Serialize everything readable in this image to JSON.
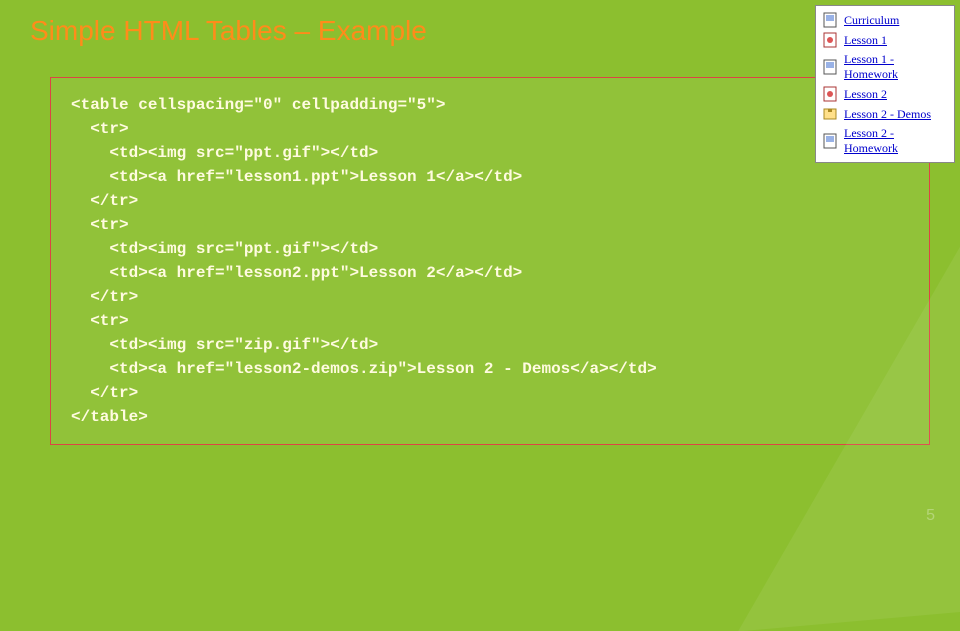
{
  "slide": {
    "title": "Simple HTML Tables – Example",
    "page_number": "5"
  },
  "code": {
    "line1": "<table cellspacing=\"0\" cellpadding=\"5\">",
    "line2": "  <tr>",
    "line3": "    <td><img src=\"ppt.gif\"></td>",
    "line4": "    <td><a href=\"lesson1.ppt\">Lesson 1</a></td>",
    "line5": "  </tr>",
    "line6": "  <tr>",
    "line7": "    <td><img src=\"ppt.gif\"></td>",
    "line8": "    <td><a href=\"lesson2.ppt\">Lesson 2</a></td>",
    "line9": "  </tr>",
    "line10": "  <tr>",
    "line11": "    <td><img src=\"zip.gif\"></td>",
    "line12": "    <td><a href=\"lesson2-demos.zip\">Lesson 2 - Demos</a></td>",
    "line13": "  </tr>",
    "line14": "</table>"
  },
  "links": {
    "items": [
      {
        "label": "Curriculum",
        "icon": "doc"
      },
      {
        "label": "Lesson 1",
        "icon": "ppt"
      },
      {
        "label": "Lesson 1 - Homework",
        "icon": "doc"
      },
      {
        "label": "Lesson 2",
        "icon": "ppt"
      },
      {
        "label": "Lesson 2 - Demos",
        "icon": "zip"
      },
      {
        "label": "Lesson 2 - Homework",
        "icon": "doc"
      }
    ]
  }
}
